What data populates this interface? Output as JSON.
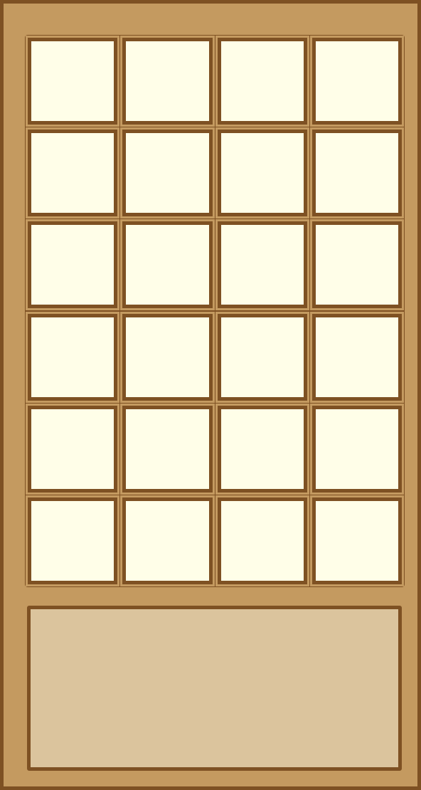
{
  "board": {
    "rows": 6,
    "cols": 4,
    "cells": [
      [
        "",
        "",
        "",
        ""
      ],
      [
        "",
        "",
        "",
        ""
      ],
      [
        "",
        "",
        "",
        ""
      ],
      [
        "",
        "",
        "",
        ""
      ],
      [
        "",
        "",
        "",
        ""
      ],
      [
        "",
        "",
        "",
        ""
      ]
    ]
  },
  "tray": {
    "items": []
  },
  "colors": {
    "frame": "#7e5123",
    "background": "#c49a60",
    "cell_fill": "#fffee8",
    "tray_fill": "#dbc49d"
  }
}
